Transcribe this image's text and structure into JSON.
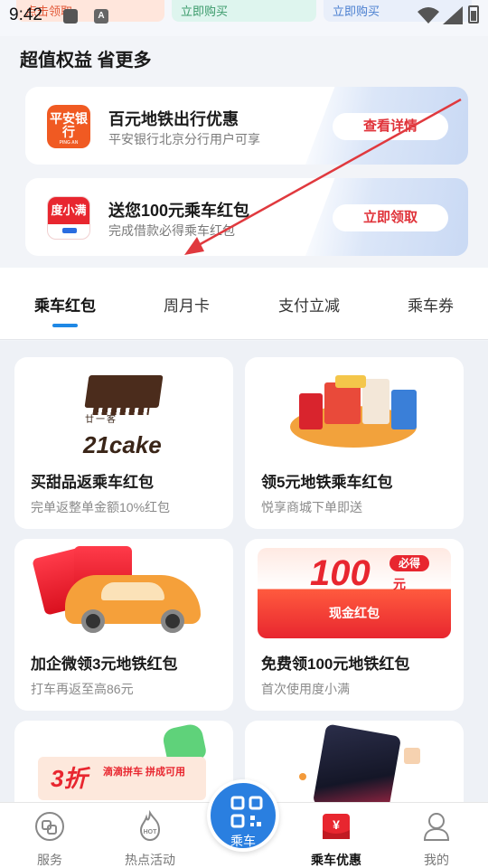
{
  "status_bar": {
    "time": "9:42"
  },
  "top_banners": [
    {
      "label": "点击领取"
    },
    {
      "label": "立即购买"
    },
    {
      "label": "立即购买"
    }
  ],
  "benefits": {
    "heading": "超值权益 省更多",
    "items": [
      {
        "logo_text": "平安银行",
        "logo_sub": "PING AN",
        "title": "百元地铁出行优惠",
        "desc": "平安银行北京分行用户可享",
        "button": "查看详情"
      },
      {
        "logo_text": "度小满",
        "title": "送您100元乘车红包",
        "desc": "完成借款必得乘车红包",
        "button": "立即领取"
      }
    ]
  },
  "tabs": [
    {
      "label": "乘车红包",
      "active": true
    },
    {
      "label": "周月卡"
    },
    {
      "label": "支付立减"
    },
    {
      "label": "乘车券"
    }
  ],
  "cards": [
    {
      "title": "买甜品返乘车红包",
      "subtitle": "完单返整单金额10%红包",
      "art": {
        "brand_top": "廿一客",
        "brand": "21cake"
      }
    },
    {
      "title": "领5元地铁乘车红包",
      "subtitle": "悦享商城下单即送"
    },
    {
      "title": "加企微领3元地铁红包",
      "subtitle": "打车再返至高86元"
    },
    {
      "title": "免费领100元地铁红包",
      "subtitle": "首次使用度小满",
      "art": {
        "amount": "100",
        "unit": "元",
        "badge": "必得",
        "label": "现金红包"
      }
    },
    {
      "art": {
        "big": "3折",
        "text": "滴滴拼车 拼成可用"
      }
    },
    {}
  ],
  "bottom_nav": [
    {
      "label": "服务",
      "icon": "service-icon"
    },
    {
      "label": "热点活动",
      "icon": "hot-icon",
      "badge": "HOT"
    },
    {
      "label": "乘车",
      "icon": "qr-code-icon"
    },
    {
      "label": "乘车优惠",
      "icon": "coupon-icon",
      "active": true
    },
    {
      "label": "我的",
      "icon": "profile-icon"
    }
  ],
  "colors": {
    "accent": "#2a7fe0",
    "red": "#e8262f",
    "tab_underline": "#1e88e5"
  }
}
